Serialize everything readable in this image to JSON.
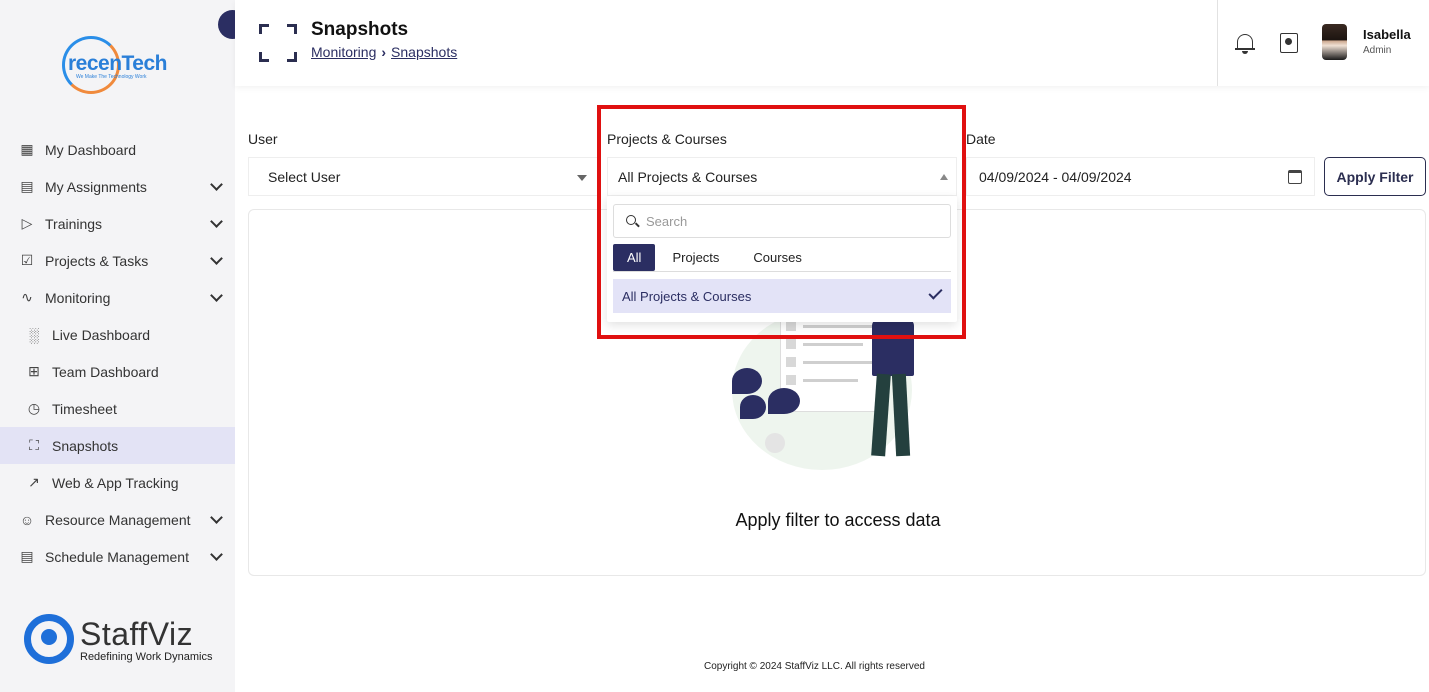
{
  "sidebar": {
    "logo": {
      "brand": "recenTech",
      "brand_prefix": "",
      "tagline": "We Make The Technology Work"
    },
    "items": [
      {
        "label": "My Dashboard",
        "icon": "grid-icon",
        "expandable": false
      },
      {
        "label": "My Assignments",
        "icon": "document-icon",
        "expandable": true
      },
      {
        "label": "Trainings",
        "icon": "video-icon",
        "expandable": true
      },
      {
        "label": "Projects & Tasks",
        "icon": "clipboard-check-icon",
        "expandable": true
      },
      {
        "label": "Monitoring",
        "icon": "monitor-graph-icon",
        "expandable": true
      },
      {
        "label": "Live Dashboard",
        "icon": "bar-chart-icon",
        "sub": true
      },
      {
        "label": "Team Dashboard",
        "icon": "grid-plus-icon",
        "sub": true
      },
      {
        "label": "Timesheet",
        "icon": "clock-icon",
        "sub": true
      },
      {
        "label": "Snapshots",
        "icon": "frame-icon",
        "sub": true,
        "active": true
      },
      {
        "label": "Web & App Tracking",
        "icon": "line-chart-icon",
        "sub": true
      },
      {
        "label": "Resource Management",
        "icon": "users-gear-icon",
        "expandable": true
      },
      {
        "label": "Schedule Management",
        "icon": "calendar-icon",
        "expandable": true
      }
    ],
    "footer_logo": {
      "name": "StaffViz",
      "tagline": "Redefining Work Dynamics"
    }
  },
  "header": {
    "title": "Snapshots",
    "breadcrumb": [
      "Monitoring",
      "Snapshots"
    ],
    "user": {
      "name": "Isabella",
      "role": "Admin"
    }
  },
  "filters": {
    "user": {
      "label": "User",
      "value": "Select User"
    },
    "projects": {
      "label": "Projects & Courses",
      "value": "All Projects & Courses"
    },
    "date": {
      "label": "Date",
      "value": "04/09/2024 - 04/09/2024"
    },
    "apply_label": "Apply Filter"
  },
  "dropdown": {
    "search_placeholder": "Search",
    "tabs": [
      "All",
      "Projects",
      "Courses"
    ],
    "active_tab": "All",
    "options": [
      {
        "label": "All Projects & Courses",
        "selected": true
      }
    ]
  },
  "main": {
    "empty_message": "Apply filter to access data"
  },
  "footer": {
    "copyright": "Copyright © 2024 StaffViz LLC. All rights reserved"
  },
  "colors": {
    "accent": "#2b2e62",
    "highlight": "#e01010",
    "active_bg": "#e3e3f5"
  }
}
